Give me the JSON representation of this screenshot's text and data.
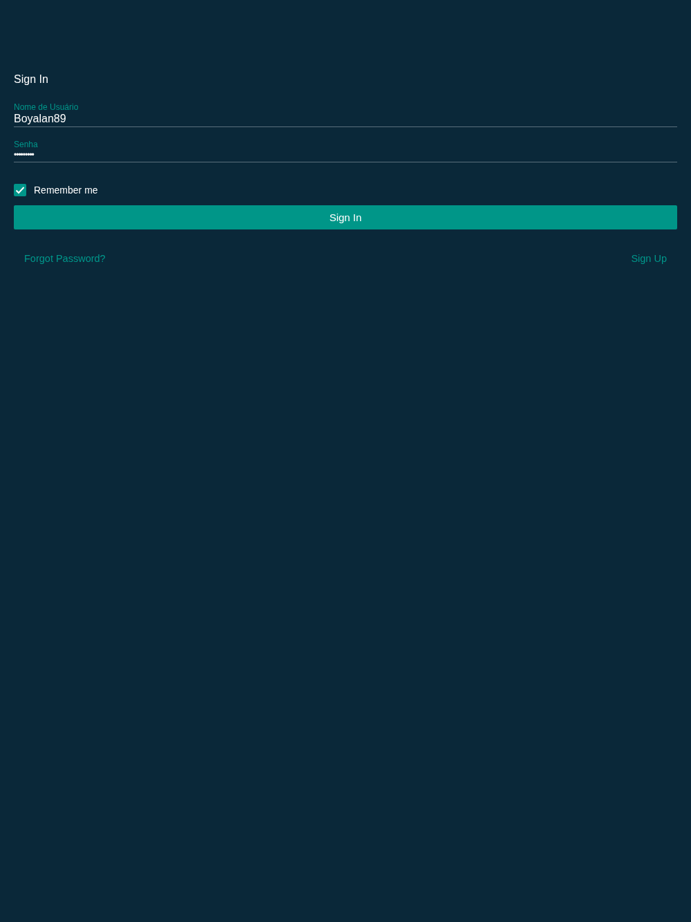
{
  "title": "Sign In",
  "fields": [
    {
      "label": "Nome de Usuário",
      "value": "Boyalan89"
    },
    {
      "label": "Senha",
      "value": "•••••••••"
    }
  ],
  "remember": {
    "label": "Remember me",
    "checked": true
  },
  "submit": "Sign In",
  "links": [
    "Forgot Password?",
    "Sign Up"
  ]
}
